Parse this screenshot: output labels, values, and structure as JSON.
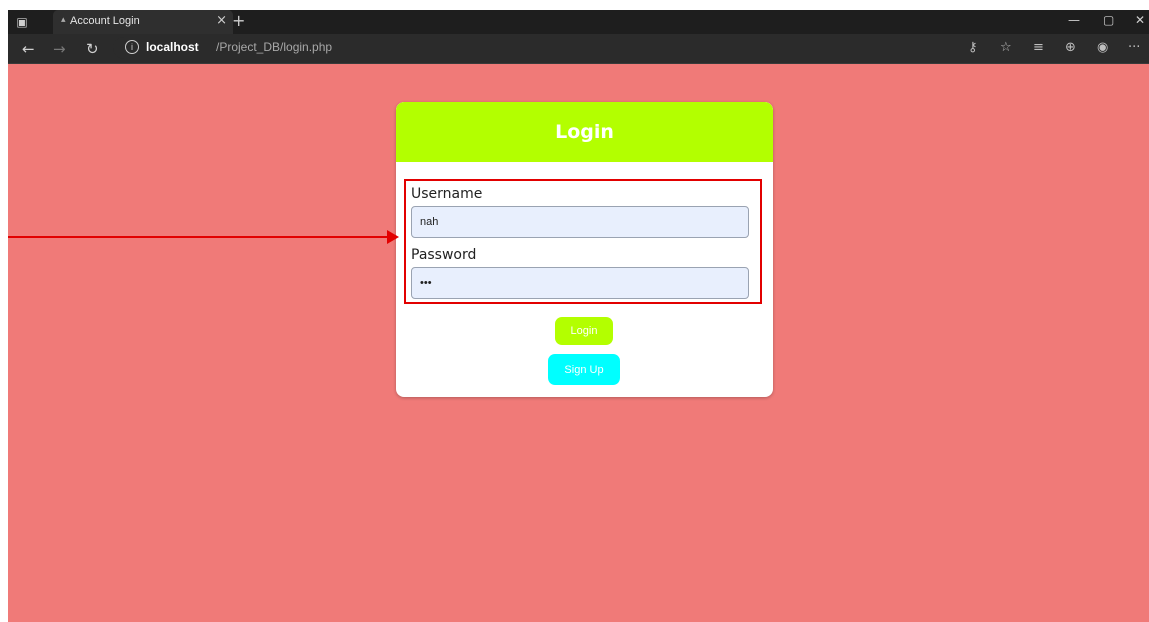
{
  "browser": {
    "tab_title": "Account Login",
    "tab_close": "×",
    "new_tab": "+",
    "url_host": "localhost",
    "url_path": "/Project_DB/login.php",
    "info_symbol": "i",
    "window_controls": {
      "minimize": "—",
      "maximize": "▢",
      "close": "✕"
    },
    "more": "···"
  },
  "login": {
    "title": "Login",
    "username_label": "Username",
    "username_value": "nah",
    "password_label": "Password",
    "password_value": "•••",
    "login_button": "Login",
    "signup_button": "Sign Up"
  },
  "colors": {
    "page_background": "#f07a78",
    "header_accent": "#b3ff00",
    "signup_accent": "#00ffff",
    "annotation": "#e20000"
  }
}
